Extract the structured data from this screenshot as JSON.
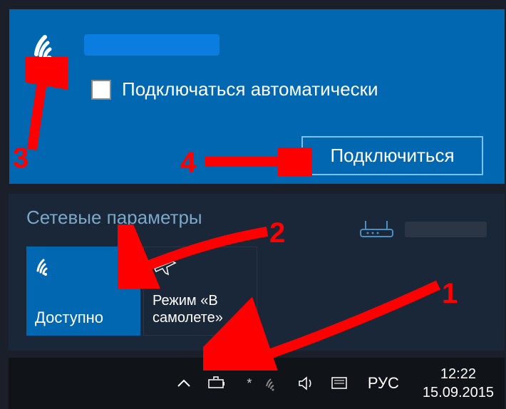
{
  "network": {
    "auto_connect_label": "Подключаться автоматически",
    "connect_button": "Подключиться"
  },
  "settings": {
    "title": "Сетевые параметры",
    "wifi_tile_label": "Доступно",
    "airplane_tile_label": "Режим «В самолете»"
  },
  "taskbar": {
    "language": "РУС",
    "time": "12:22",
    "date": "15.09.2015"
  },
  "annotations": {
    "n1": "1",
    "n2": "2",
    "n3": "3",
    "n4": "4"
  }
}
